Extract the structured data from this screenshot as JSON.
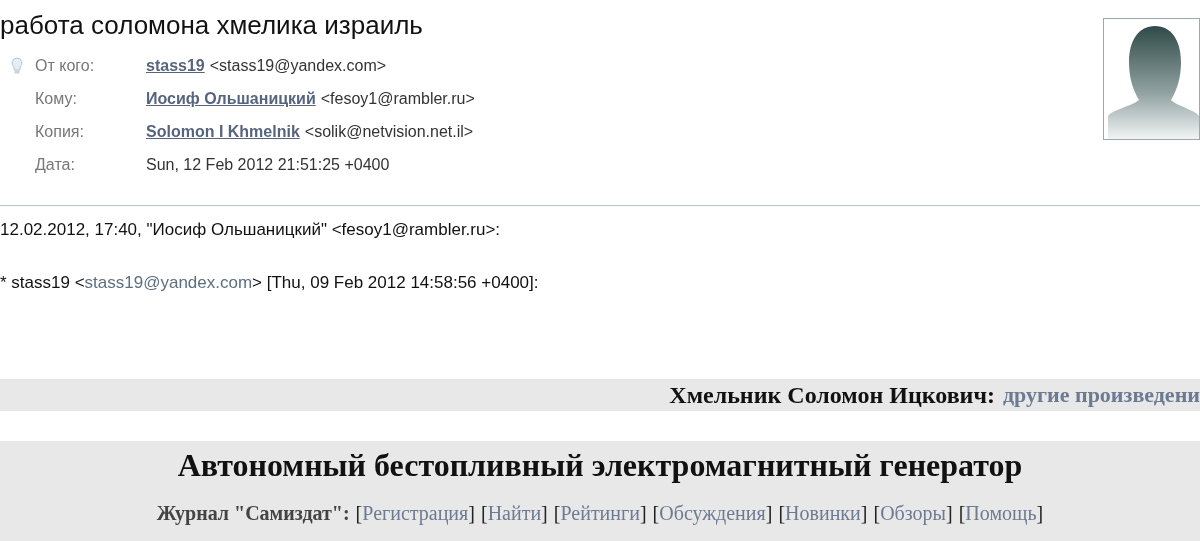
{
  "subject": "работа соломона хмелика израиль",
  "headers": [
    {
      "label": "От кого:",
      "name": "stass19",
      "address": "<stass19@yandex.com>"
    },
    {
      "label": "Кому:",
      "name": "Иосиф Ольшаницкий",
      "address": "<fesoy1@rambler.ru>"
    },
    {
      "label": "Копия:",
      "name": "Solomon I Khmelnik",
      "address": "<solik@netvision.net.il>"
    },
    {
      "label": "Дата:",
      "value": "Sun, 12 Feb 2012 21:51:25 +0400"
    }
  ],
  "body": {
    "quote_line": "12.02.2012, 17:40, \"Иосиф Ольшаницкий\" <fesoy1@rambler.ru>:",
    "cite": {
      "before": "* stass19 <",
      "link": "stass19@yandex.com",
      "after": "> [Thu, 09 Feb 2012 14:58:56 +0400]:"
    }
  },
  "author_bar": {
    "name": "Хмельник Соломон Ицкович:",
    "link": "другие произведени"
  },
  "page": {
    "title": "Автономный бестопливный электромагнитный генератор",
    "journal": "Журнал \"Самиздат\":",
    "nav": [
      {
        "before": "[",
        "label": "Регистрация",
        "after": "]"
      },
      {
        "before": "[",
        "label": "Найти",
        "after": "]"
      },
      {
        "before": "[",
        "label": "Рейтинги",
        "after": "]"
      },
      {
        "before": "[",
        "label": "Обсуждения",
        "after": "]"
      },
      {
        "before": "[",
        "label": "Новинки",
        "after": "]"
      },
      {
        "before": "[",
        "label": "Обзоры",
        "after": "]"
      },
      {
        "before": "[",
        "label": "Помощь",
        "after": "]"
      }
    ]
  }
}
